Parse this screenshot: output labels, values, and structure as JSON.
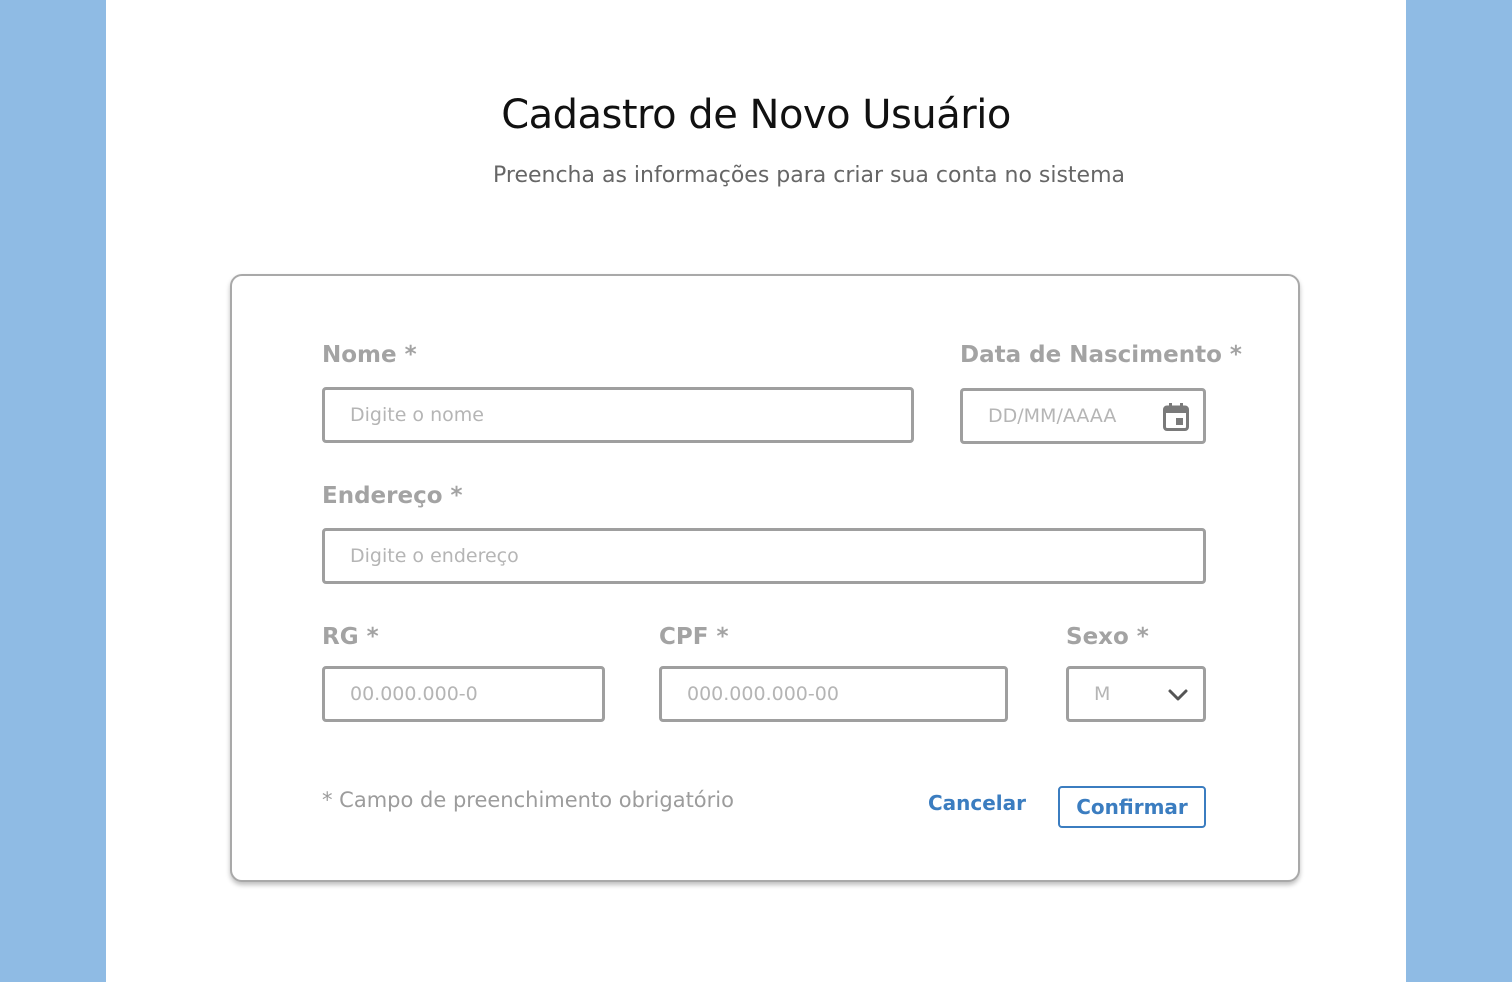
{
  "header": {
    "title": "Cadastro de Novo Usuário",
    "subtitle": "Preencha as informações para criar sua conta no sistema"
  },
  "form": {
    "nome": {
      "label": "Nome *",
      "placeholder": "Digite o nome",
      "value": ""
    },
    "data_nascimento": {
      "label": "Data de Nascimento *",
      "placeholder": "DD/MM/AAAA",
      "value": "",
      "icon": "calendar-icon"
    },
    "endereco": {
      "label": "Endereço *",
      "placeholder": "Digite o endereço",
      "value": ""
    },
    "rg": {
      "label": "RG *",
      "placeholder": "00.000.000-0",
      "value": ""
    },
    "cpf": {
      "label": "CPF *",
      "placeholder": "000.000.000-00",
      "value": ""
    },
    "sexo": {
      "label": "Sexo *",
      "selected": "M",
      "icon": "chevron-down-icon"
    },
    "required_note": "* Campo de preenchimento obrigatório"
  },
  "actions": {
    "cancel_label": "Cancelar",
    "confirm_label": "Confirmar"
  },
  "colors": {
    "background": "#8fbbe4",
    "accent": "#3b7dc0",
    "label": "#a3a3a3",
    "border": "#9f9f9f"
  }
}
